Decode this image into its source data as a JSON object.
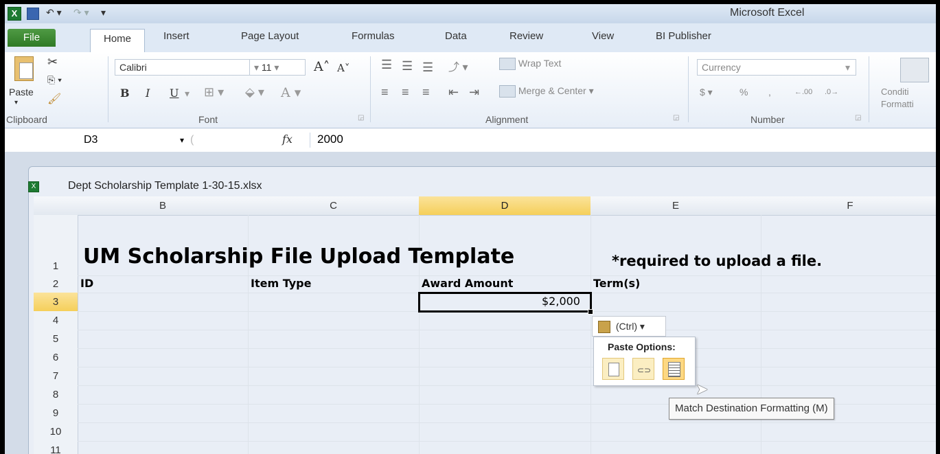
{
  "app": {
    "title": "Microsoft Excel"
  },
  "tabs": [
    {
      "label": "File"
    },
    {
      "label": "Home"
    },
    {
      "label": "Insert"
    },
    {
      "label": "Page Layout"
    },
    {
      "label": "Formulas"
    },
    {
      "label": "Data"
    },
    {
      "label": "Review"
    },
    {
      "label": "View"
    },
    {
      "label": "BI Publisher"
    }
  ],
  "ribbon": {
    "clipboard": {
      "paste_label": "Paste",
      "group_label": "Clipboard"
    },
    "font": {
      "name": "Calibri",
      "size": "11",
      "group_label": "Font",
      "bold": "B",
      "italic": "I",
      "underline": "U",
      "grow": "A",
      "shrink": "A",
      "color_a": "A"
    },
    "alignment": {
      "wrap_text": "Wrap Text",
      "merge_center": "Merge & Center",
      "group_label": "Alignment"
    },
    "number": {
      "format": "Currency",
      "currency_symbol": "$",
      "percent": "%",
      "comma": ",",
      "group_label": "Number",
      "inc_decimal": ".00",
      "dec_decimal": ".0"
    },
    "styles": {
      "conditional_line1": "Conditi",
      "conditional_line2": "Formatti"
    }
  },
  "formula_bar": {
    "name_box": "D3",
    "fx": "fx",
    "value": "2000"
  },
  "workbook": {
    "title": "Dept Scholarship Template 1-30-15.xlsx"
  },
  "columns": [
    "B",
    "C",
    "D",
    "E",
    "F"
  ],
  "rows": [
    "1",
    "2",
    "3",
    "4",
    "5",
    "6",
    "7",
    "8",
    "9",
    "10",
    "11"
  ],
  "cells": {
    "title": "UM Scholarship File Upload Template",
    "required_note": "*required to upload a file.",
    "b2": "ID",
    "c2": "Item Type",
    "d2": "Award Amount",
    "e2": "Term(s)",
    "d3": "$2,000"
  },
  "paste_popup": {
    "button_label": "(Ctrl) ▾",
    "menu_title": "Paste Options:",
    "tooltip": "Match Destination Formatting (M)"
  },
  "colors": {
    "file_tab": "#3d8a33",
    "selection_header": "#f5cf5a"
  }
}
